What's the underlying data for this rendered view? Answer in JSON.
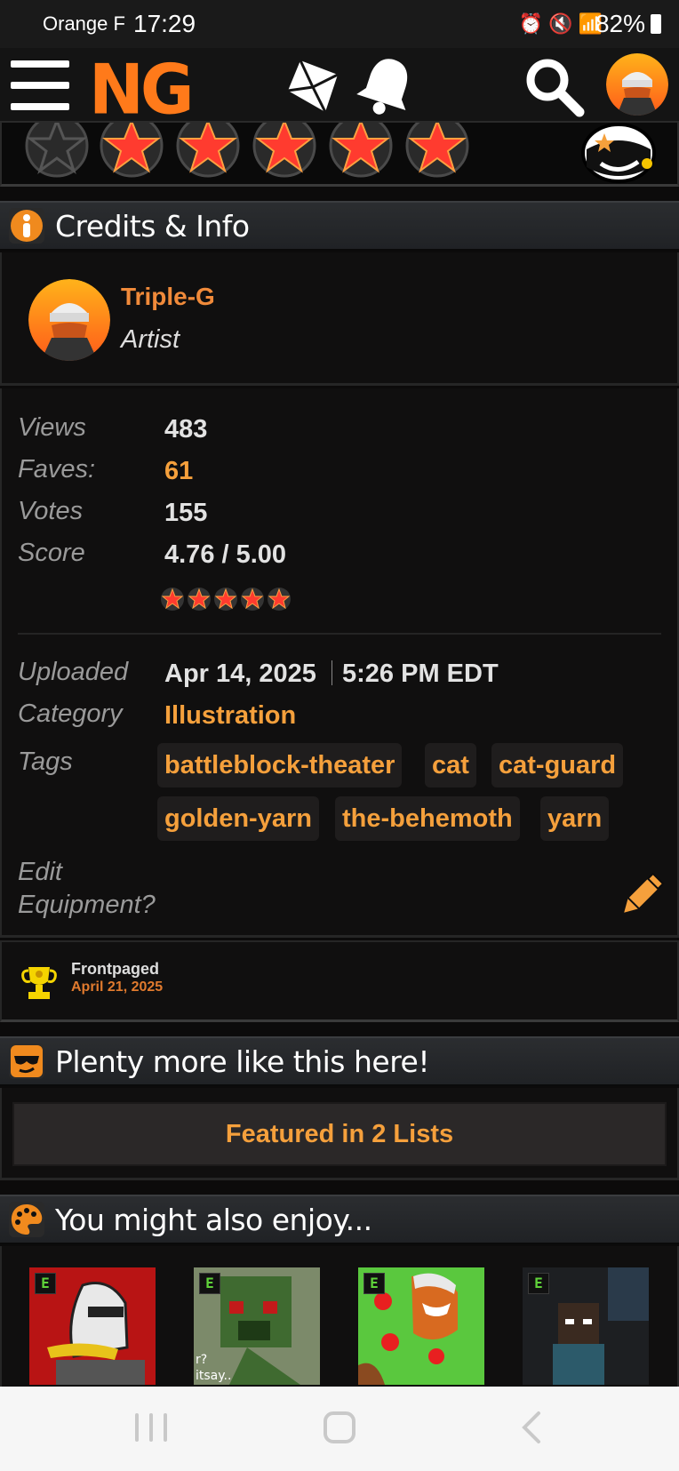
{
  "status_bar": {
    "carrier": "Orange F",
    "time": "17:29",
    "battery": "82%",
    "icons": [
      "alarm-icon",
      "mute-icon",
      "wifi-icon",
      "signal-icon",
      "battery-icon"
    ]
  },
  "nav": {
    "logo": "NG",
    "icons": [
      "menu-icon",
      "gem-icon",
      "bell-icon",
      "search-icon",
      "avatar"
    ]
  },
  "rating_strip": {
    "stars_shown": 6,
    "first_star_state": "empty"
  },
  "credits": {
    "header": "Credits & Info",
    "author_name": "Triple-G",
    "author_role": "Artist"
  },
  "stats": {
    "views_label": "Views",
    "views_value": "483",
    "faves_label": "Faves:",
    "faves_value": "61",
    "votes_label": "Votes",
    "votes_value": "155",
    "score_label": "Score",
    "score_value": "4.76 / 5.00",
    "score_stars": 5
  },
  "info": {
    "uploaded_label": "Uploaded",
    "uploaded_date": "Apr 14, 2025",
    "uploaded_time": "5:26 PM EDT",
    "category_label": "Category",
    "category_value": "Illustration",
    "tags_label": "Tags",
    "tags": [
      "battleblock-theater",
      "cat",
      "cat-guard",
      "golden-yarn",
      "the-behemoth",
      "yarn"
    ],
    "edit_label_1": "Edit",
    "edit_label_2": "Equipment?"
  },
  "frontpaged": {
    "title": "Frontpaged",
    "date": "April 21, 2025"
  },
  "more": {
    "header": "Plenty more like this here!",
    "button": "Featured in 2 Lists"
  },
  "enjoy": {
    "header": "You might also enjoy...",
    "thumb_badge": "E"
  },
  "colors": {
    "accent_orange": "#f5a03c",
    "author_orange": "#f08a3a",
    "star_red": "#ff3b2f",
    "background": "#0c0b0b"
  }
}
